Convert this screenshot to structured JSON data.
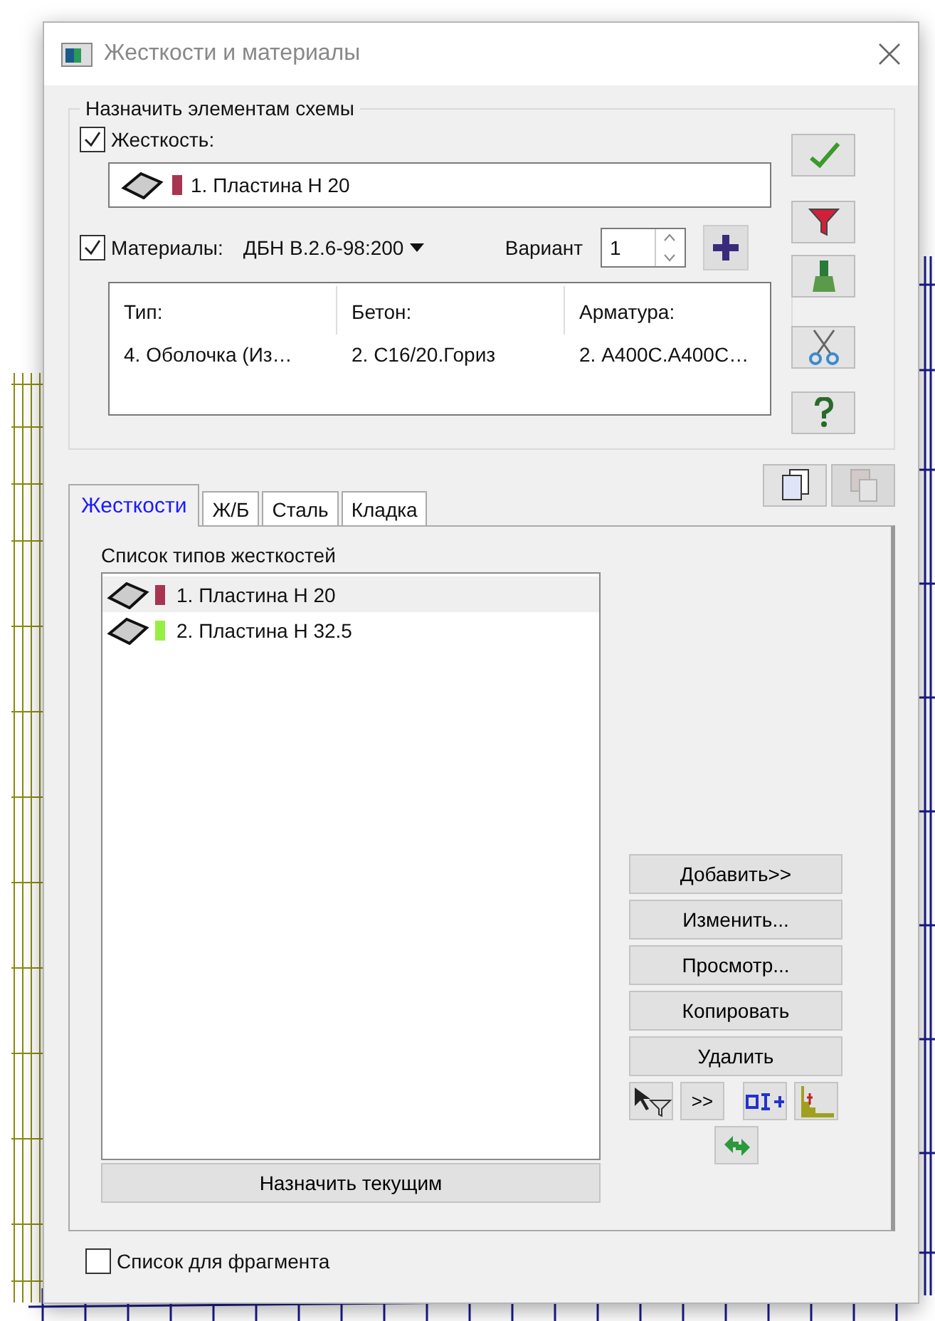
{
  "window": {
    "title": "Жесткости и материалы"
  },
  "assign_group": {
    "legend": "Назначить элементам схемы",
    "stiffness": {
      "label": "Жесткость:",
      "checked": true,
      "value": "1. Пластина  Н 20",
      "color": "#a8354f"
    },
    "materials": {
      "label": "Материалы:",
      "checked": true,
      "norm": "ДБН В.2.6-98:200",
      "variant_label": "Вариант",
      "variant": "1"
    },
    "table": {
      "columns": [
        "Тип:",
        "Бетон:",
        "Арматура:"
      ],
      "rows": [
        [
          "4. Оболочка (Из…",
          "2. С16/20.Гориз",
          "2. А400С.А400С…"
        ]
      ]
    }
  },
  "tabs": [
    {
      "label": "Жесткости",
      "selected": true
    },
    {
      "label": "Ж/Б",
      "selected": false
    },
    {
      "label": "Сталь",
      "selected": false
    },
    {
      "label": "Кладка",
      "selected": false
    }
  ],
  "list": {
    "title": "Список типов жесткостей",
    "items": [
      {
        "text": "1. Пластина  Н 20",
        "color": "#a8354f",
        "selected": true
      },
      {
        "text": "2. Пластина  Н 32.5",
        "color": "#99ee44",
        "selected": false
      }
    ]
  },
  "buttons": [
    "Добавить>>",
    "Изменить...",
    "Просмотр...",
    "Копировать",
    "Удалить"
  ],
  "small_buttons": [
    ">>"
  ],
  "assign_button": "Назначить текущим",
  "fragment": {
    "label": "Список для фрагмента",
    "checked": false
  }
}
